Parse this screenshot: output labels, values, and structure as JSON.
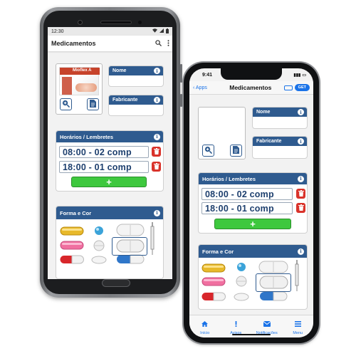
{
  "android": {
    "status": {
      "time": "12:30"
    },
    "appbar": {
      "title": "Medicamentos",
      "search_icon": "search-icon",
      "more_icon": "more-vert-icon"
    },
    "photo": {
      "box_label": "Mioflex A"
    },
    "fields": {
      "name_label": "Nome",
      "maker_label": "Fabricante"
    },
    "schedule": {
      "title": "Horários / Lembretes",
      "rows": [
        {
          "text": "08:00 - 02 comp"
        },
        {
          "text": "18:00 - 01 comp"
        }
      ],
      "add_label": "+"
    },
    "shape": {
      "title": "Forma e Cor"
    }
  },
  "iphone": {
    "status": {
      "time": "9:41"
    },
    "navbar": {
      "back": "Apps",
      "title": "Medicamentos",
      "get": "GET"
    },
    "fields": {
      "name_label": "Nome",
      "maker_label": "Fabricante"
    },
    "schedule": {
      "title": "Horários / Lembretes",
      "rows": [
        {
          "text": "08:00 - 02 comp"
        },
        {
          "text": "18:00 - 01 comp"
        }
      ],
      "add_label": "+"
    },
    "shape": {
      "title": "Forma e Cor"
    },
    "tabs": [
      {
        "label": "Início",
        "icon": "home-icon"
      },
      {
        "label": "Avisos",
        "icon": "alert-icon"
      },
      {
        "label": "Notificações",
        "icon": "mail-icon"
      },
      {
        "label": "Menu",
        "icon": "menu-icon"
      }
    ]
  },
  "colors": {
    "header_blue": "#2f5b8f",
    "time_text": "#1d3f6e",
    "delete_red": "#d9332b",
    "add_green": "#3ec83e",
    "ios_accent": "#1a73e8"
  }
}
